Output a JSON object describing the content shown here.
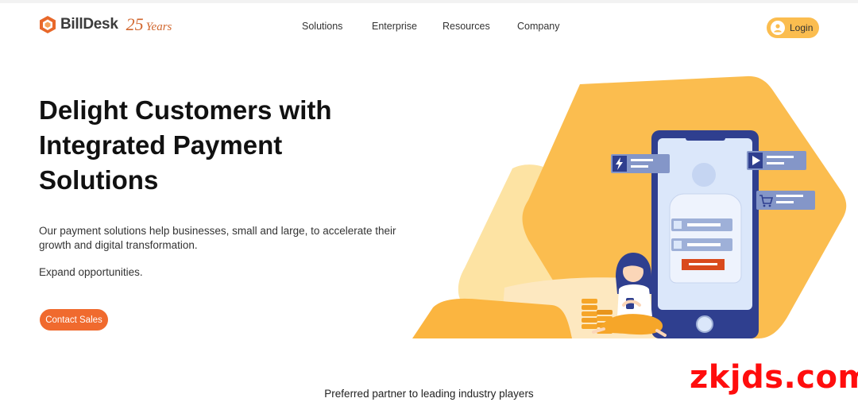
{
  "brand": {
    "name": "BillDesk",
    "years_number": "25",
    "years_word": "Years"
  },
  "nav": {
    "items": [
      "Solutions",
      "Enterprise",
      "Resources",
      "Company"
    ]
  },
  "header": {
    "login_label": "Login"
  },
  "hero": {
    "title_lines": [
      "Delight Customers with",
      "Integrated Payment",
      "Solutions"
    ],
    "description": "Our payment solutions help businesses, small and large, to accelerate their growth and digital transformation.",
    "subtext": "Expand opportunities.",
    "cta_label": "Contact Sales"
  },
  "partners": {
    "heading": "Preferred partner to leading industry players"
  },
  "watermark": {
    "text": "zkjds.com"
  },
  "colors": {
    "accent": "#f06a2e",
    "yellow": "#fbbd4f",
    "phone": "#2f3f8f",
    "screen": "#dbe7fa",
    "card": "#7f92c4"
  }
}
